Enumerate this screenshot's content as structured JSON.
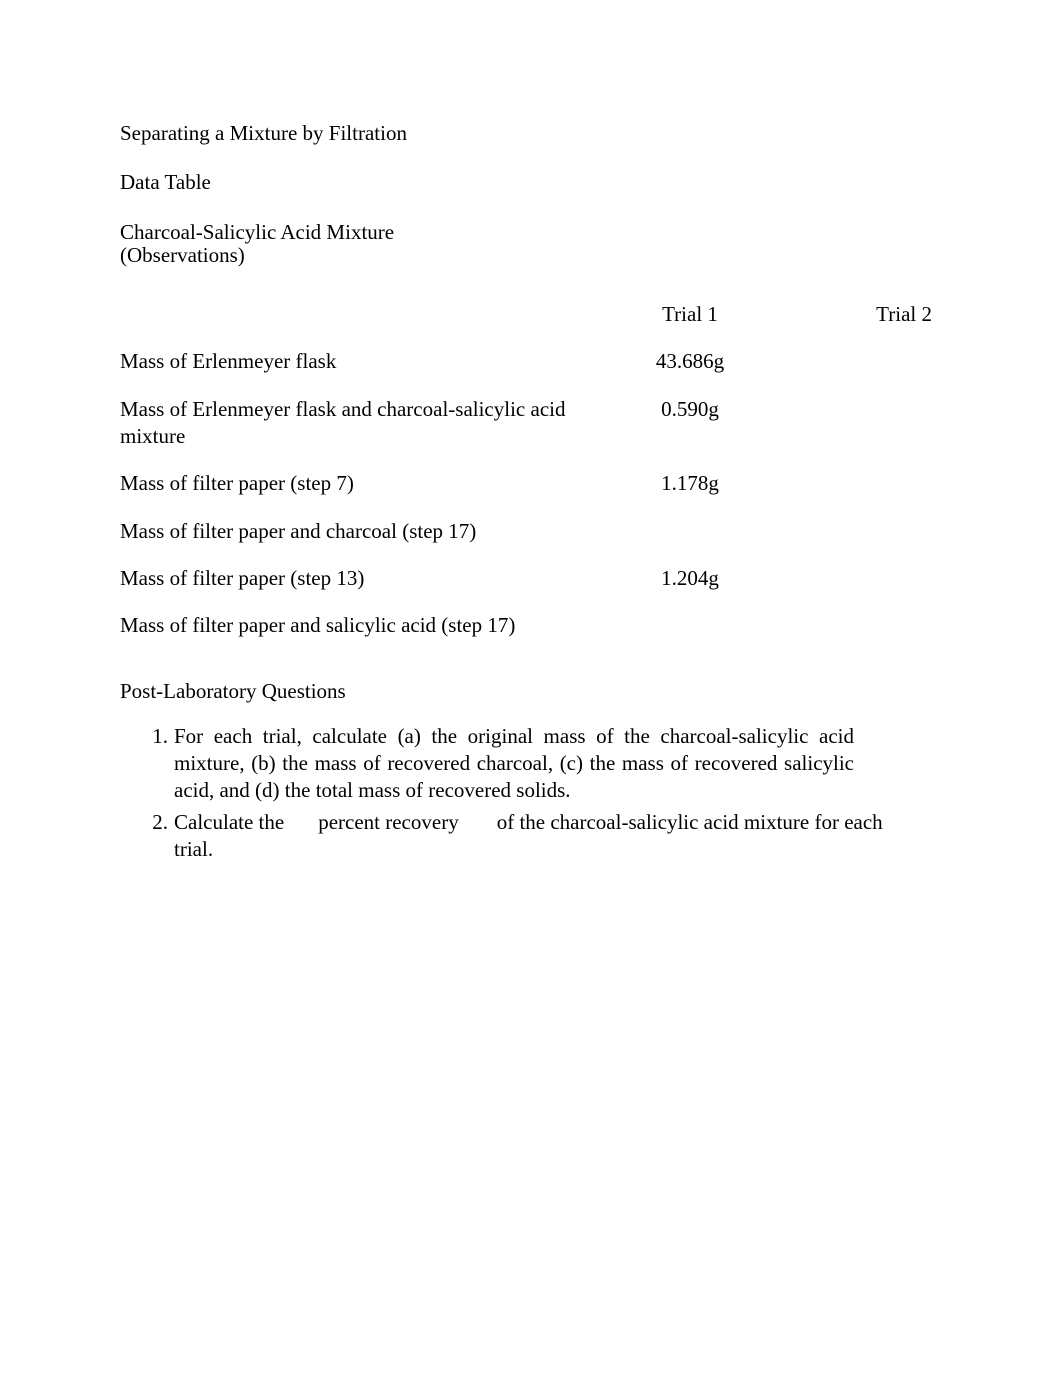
{
  "title": "Separating a Mixture by Filtration",
  "section_data_table": "Data Table",
  "mixture_line": "Charcoal-Salicylic Acid Mixture",
  "observations_line": "(Observations)",
  "col_trial1": "Trial 1",
  "col_trial2": "Trial 2",
  "rows": [
    {
      "label": "Mass of Erlenmeyer flask",
      "t1": "43.686g",
      "t2": ""
    },
    {
      "label": "Mass of Erlenmeyer flask and charcoal-salicylic acid mixture",
      "t1": "0.590g",
      "t2": ""
    },
    {
      "label": "Mass of filter paper (step 7)",
      "t1": "1.178g",
      "t2": ""
    },
    {
      "label": "Mass of filter paper and charcoal (step 17)",
      "t1": "",
      "t2": ""
    },
    {
      "label": "Mass of filter paper (step 13)",
      "t1": "1.204g",
      "t2": ""
    },
    {
      "label": "Mass of filter paper and salicylic acid (step 17)",
      "t1": "",
      "t2": ""
    }
  ],
  "post_lab_header": "Post-Laboratory Questions",
  "q1": "For each trial, calculate (a) the original mass of the charcoal-salicylic acid mixture, (b) the mass of recovered charcoal, (c) the mass of recovered salicylic acid, and (d) the total mass of recovered solids.",
  "q2_seg1": "Calculate the",
  "q2_seg2": "percent recovery",
  "q2_seg3": "of the charcoal-salicylic acid mixture for each",
  "q2_line2": "trial."
}
